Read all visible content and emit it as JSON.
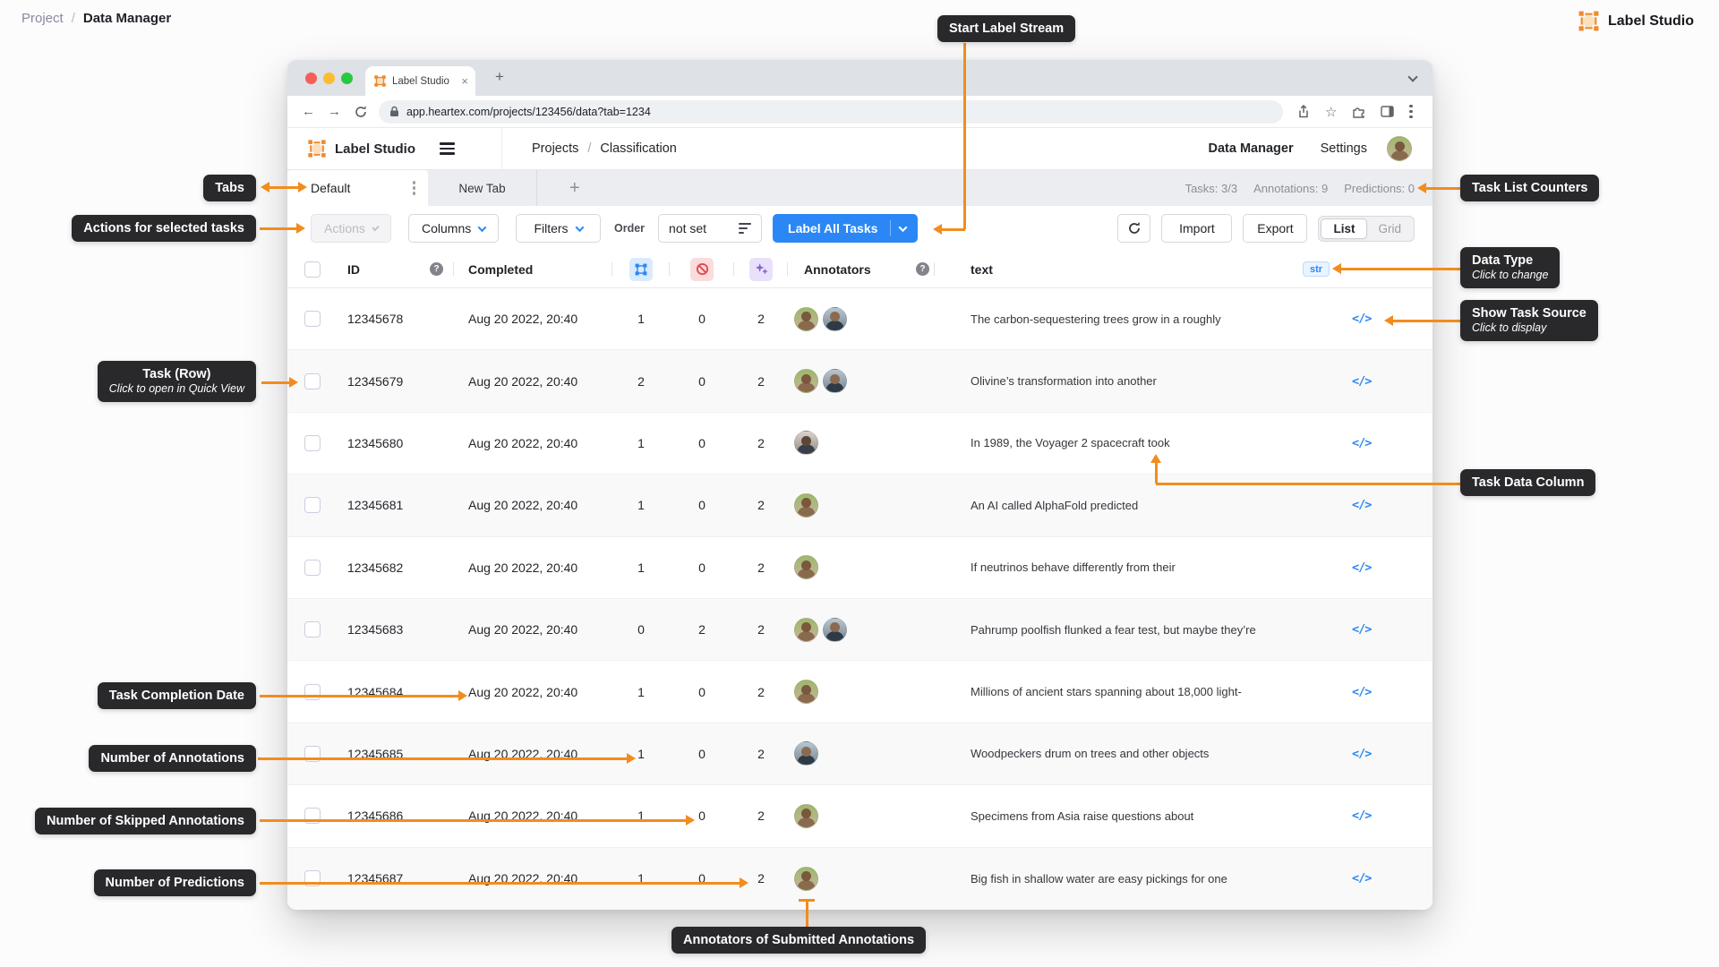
{
  "colors": {
    "accent_orange": "#F28C1E",
    "primary_blue": "#2B87F5",
    "callout_bg": "#29292B"
  },
  "page_header": {
    "breadcrumb_project": "Project",
    "breadcrumb_sep": "/",
    "breadcrumb_current": "Data Manager",
    "brand": "Label Studio"
  },
  "callouts": {
    "start_label_stream": "Start Label Stream",
    "tabs": "Tabs",
    "actions": "Actions for selected tasks",
    "task_row_title": "Task (Row)",
    "task_row_sub": "Click to open in Quick View",
    "completion_date": "Task Completion Date",
    "num_annotations": "Number of Annotations",
    "num_skipped": "Number of Skipped Annotations",
    "num_predictions": "Number of Predictions",
    "task_list_counters": "Task List Counters",
    "data_type_title": "Data Type",
    "data_type_sub": "Click to change",
    "task_source_title": "Show Task Source",
    "task_source_sub": "Click to display",
    "task_data_column": "Task Data Column",
    "annotators_submitted": "Annotators of Submitted Annotations"
  },
  "browser": {
    "tab_title": "Label Studio",
    "close_glyph": "×",
    "new_tab_glyph": "+",
    "back_glyph": "←",
    "forward_glyph": "→",
    "url": "app.heartex.com/projects/123456/data?tab=1234",
    "star_glyph": "☆"
  },
  "app_header": {
    "brand": "Label Studio",
    "nav_projects": "Projects",
    "nav_sep": "/",
    "nav_project_name": "Classification",
    "menu_data_manager": "Data Manager",
    "menu_settings": "Settings"
  },
  "tabs_bar": {
    "active_tab": "Default",
    "second_tab": "New Tab",
    "add_tab_glyph": "+",
    "counters": {
      "tasks": "Tasks: 3/3",
      "annotations": "Annotations: 9",
      "predictions": "Predictions: 0"
    }
  },
  "toolbar": {
    "actions": "Actions",
    "columns": "Columns",
    "filters": "Filters",
    "order_label": "Order",
    "order_value": "not set",
    "label_all_tasks": "Label All Tasks",
    "import": "Import",
    "export": "Export",
    "view_list": "List",
    "view_grid": "Grid"
  },
  "table": {
    "headers": {
      "id": "ID",
      "completed": "Completed",
      "annotators": "Annotators",
      "text": "text",
      "type_badge": "str",
      "help_glyph": "?"
    },
    "source_icon_glyph": "</>",
    "rows": [
      {
        "id": "12345678",
        "completed": "Aug 20 2022, 20:40",
        "annotations": "1",
        "skipped": "0",
        "predictions": "2",
        "annotators": [
          "w",
          "m"
        ],
        "text": "The carbon-sequestering trees grow in a roughly"
      },
      {
        "id": "12345679",
        "completed": "Aug 20 2022, 20:40",
        "annotations": "2",
        "skipped": "0",
        "predictions": "2",
        "annotators": [
          "w",
          "m"
        ],
        "text": "Olivine’s transformation into another"
      },
      {
        "id": "12345680",
        "completed": "Aug 20 2022, 20:40",
        "annotations": "1",
        "skipped": "0",
        "predictions": "2",
        "annotators": [
          "b"
        ],
        "text": "In 1989, the Voyager 2 spacecraft took"
      },
      {
        "id": "12345681",
        "completed": "Aug 20 2022, 20:40",
        "annotations": "1",
        "skipped": "0",
        "predictions": "2",
        "annotators": [
          "w"
        ],
        "text": "An AI called AlphaFold predicted"
      },
      {
        "id": "12345682",
        "completed": "Aug 20 2022, 20:40",
        "annotations": "1",
        "skipped": "0",
        "predictions": "2",
        "annotators": [
          "w"
        ],
        "text": "If neutrinos behave differently from their"
      },
      {
        "id": "12345683",
        "completed": "Aug 20 2022, 20:40",
        "annotations": "0",
        "skipped": "2",
        "predictions": "2",
        "annotators": [
          "w",
          "m"
        ],
        "text": "Pahrump poolfish flunked a fear test, but maybe they’re"
      },
      {
        "id": "12345684",
        "completed": "Aug 20 2022, 20:40",
        "annotations": "1",
        "skipped": "0",
        "predictions": "2",
        "annotators": [
          "w"
        ],
        "text": "Millions of ancient stars spanning about 18,000 light-"
      },
      {
        "id": "12345685",
        "completed": "Aug 20 2022, 20:40",
        "annotations": "1",
        "skipped": "0",
        "predictions": "2",
        "annotators": [
          "m"
        ],
        "text": "Woodpeckers drum on trees and other objects"
      },
      {
        "id": "12345686",
        "completed": "Aug 20 2022, 20:40",
        "annotations": "1",
        "skipped": "0",
        "predictions": "2",
        "annotators": [
          "w"
        ],
        "text": "Specimens from Asia raise questions about"
      },
      {
        "id": "12345687",
        "completed": "Aug 20 2022, 20:40",
        "annotations": "1",
        "skipped": "0",
        "predictions": "2",
        "annotators": [
          "w"
        ],
        "text": "Big fish in shallow water are easy pickings for one"
      }
    ]
  }
}
